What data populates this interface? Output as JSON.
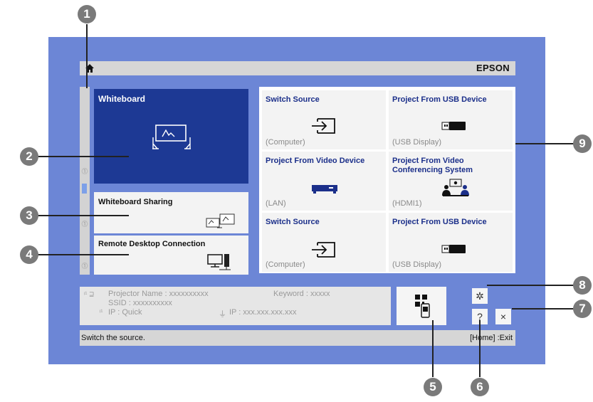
{
  "header": {
    "brand": "EPSON"
  },
  "sidebar": {
    "whiteboard": {
      "title": "Whiteboard"
    },
    "sharing": {
      "title": "Whiteboard Sharing"
    },
    "remote": {
      "title": "Remote Desktop Connection"
    }
  },
  "grid": [
    {
      "title": "Switch Source",
      "sub": "(Computer)",
      "icon": "input-arrow-icon"
    },
    {
      "title": "Project From USB Device",
      "sub": "(USB Display)",
      "icon": "usb-drive-icon"
    },
    {
      "title": "Project From Video Device",
      "sub": "(LAN)",
      "icon": "video-device-icon"
    },
    {
      "title": "Project From Video Conferencing System",
      "sub": "(HDMI1)",
      "icon": "conference-icon"
    },
    {
      "title": "Switch Source",
      "sub": "(Computer)",
      "icon": "input-arrow-icon"
    },
    {
      "title": "Project From USB Device",
      "sub": "(USB Display)",
      "icon": "usb-drive-icon"
    }
  ],
  "info": {
    "projector_name": "Projector Name : xxxxxxxxxx",
    "keyword": "Keyword : xxxxx",
    "ssid": "SSID : xxxxxxxxxx",
    "wifi_ip": "IP : Quick",
    "lan_ip": "IP : xxx.xxx.xxx.xxx"
  },
  "status": {
    "left": "Switch the source.",
    "right": "[Home] :Exit"
  },
  "buttons": {
    "help": "?",
    "close": "×"
  },
  "callouts": [
    "1",
    "2",
    "3",
    "4",
    "5",
    "6",
    "7",
    "8",
    "9"
  ],
  "colors": {
    "background": "#6c86d6",
    "selected": "#1d3994",
    "link_text": "#1b2f8a",
    "callout": "#7a7a7a"
  }
}
